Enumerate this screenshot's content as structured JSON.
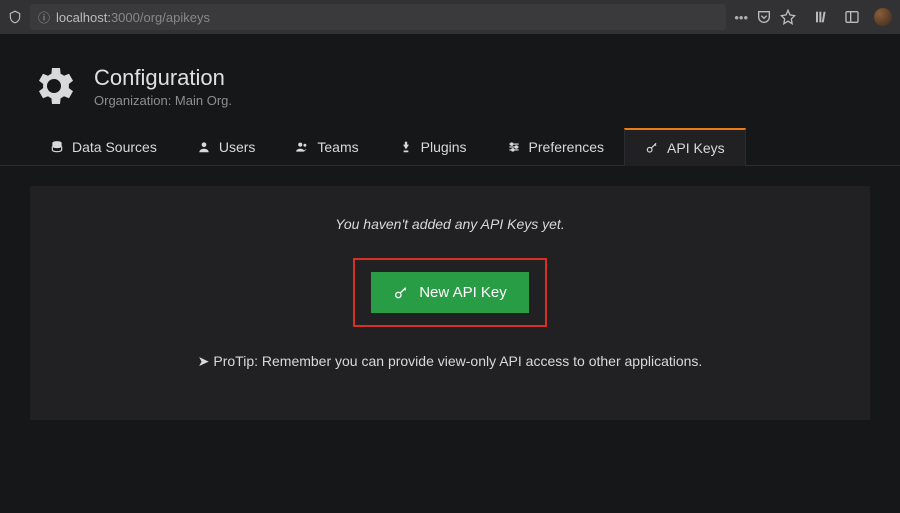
{
  "browser": {
    "url_prefix": "localhost:",
    "url_suffix": "3000/org/apikeys"
  },
  "header": {
    "title": "Configuration",
    "subtitle": "Organization: Main Org."
  },
  "tabs": [
    {
      "label": "Data Sources"
    },
    {
      "label": "Users"
    },
    {
      "label": "Teams"
    },
    {
      "label": "Plugins"
    },
    {
      "label": "Preferences"
    },
    {
      "label": "API Keys"
    }
  ],
  "content": {
    "empty_message": "You haven't added any API Keys yet.",
    "new_button_label": "New API Key",
    "protip": "ProTip: Remember you can provide view-only API access to other applications."
  }
}
